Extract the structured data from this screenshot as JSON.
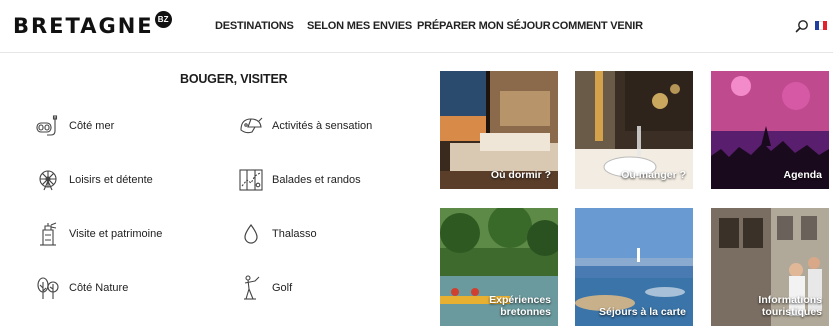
{
  "header": {
    "logo_text": "BRETAGNE",
    "logo_badge": "BZ",
    "nav": [
      {
        "label": "DESTINATIONS"
      },
      {
        "label": "SELON MES ENVIES"
      },
      {
        "label": "PRÉPARER MON SÉJOUR"
      },
      {
        "label": "COMMENT VENIR"
      }
    ],
    "search_icon": "search-icon",
    "flag_icon": "french-flag-icon",
    "flag_colors": [
      "#1f3f9e",
      "#ffffff",
      "#e3202c"
    ]
  },
  "menu": {
    "title": "BOUGER, VISITER",
    "items": [
      {
        "label": "Côté mer",
        "icon": "snorkel-icon"
      },
      {
        "label": "Activités à sensation",
        "icon": "helmet-icon"
      },
      {
        "label": "Loisirs et détente",
        "icon": "ferris-wheel-icon"
      },
      {
        "label": "Balades et randos",
        "icon": "map-icon"
      },
      {
        "label": "Visite et patrimoine",
        "icon": "lighthouse-icon"
      },
      {
        "label": "Thalasso",
        "icon": "water-drop-icon"
      },
      {
        "label": "Côté Nature",
        "icon": "trees-icon"
      },
      {
        "label": "Golf",
        "icon": "golf-icon"
      }
    ]
  },
  "tiles": [
    {
      "label": "Où dormir ?"
    },
    {
      "label": "Où manger ?"
    },
    {
      "label": "Agenda"
    },
    {
      "label": "Expériences bretonnes"
    },
    {
      "label": "Séjours à la carte"
    },
    {
      "label": "Informations touristiques"
    }
  ]
}
